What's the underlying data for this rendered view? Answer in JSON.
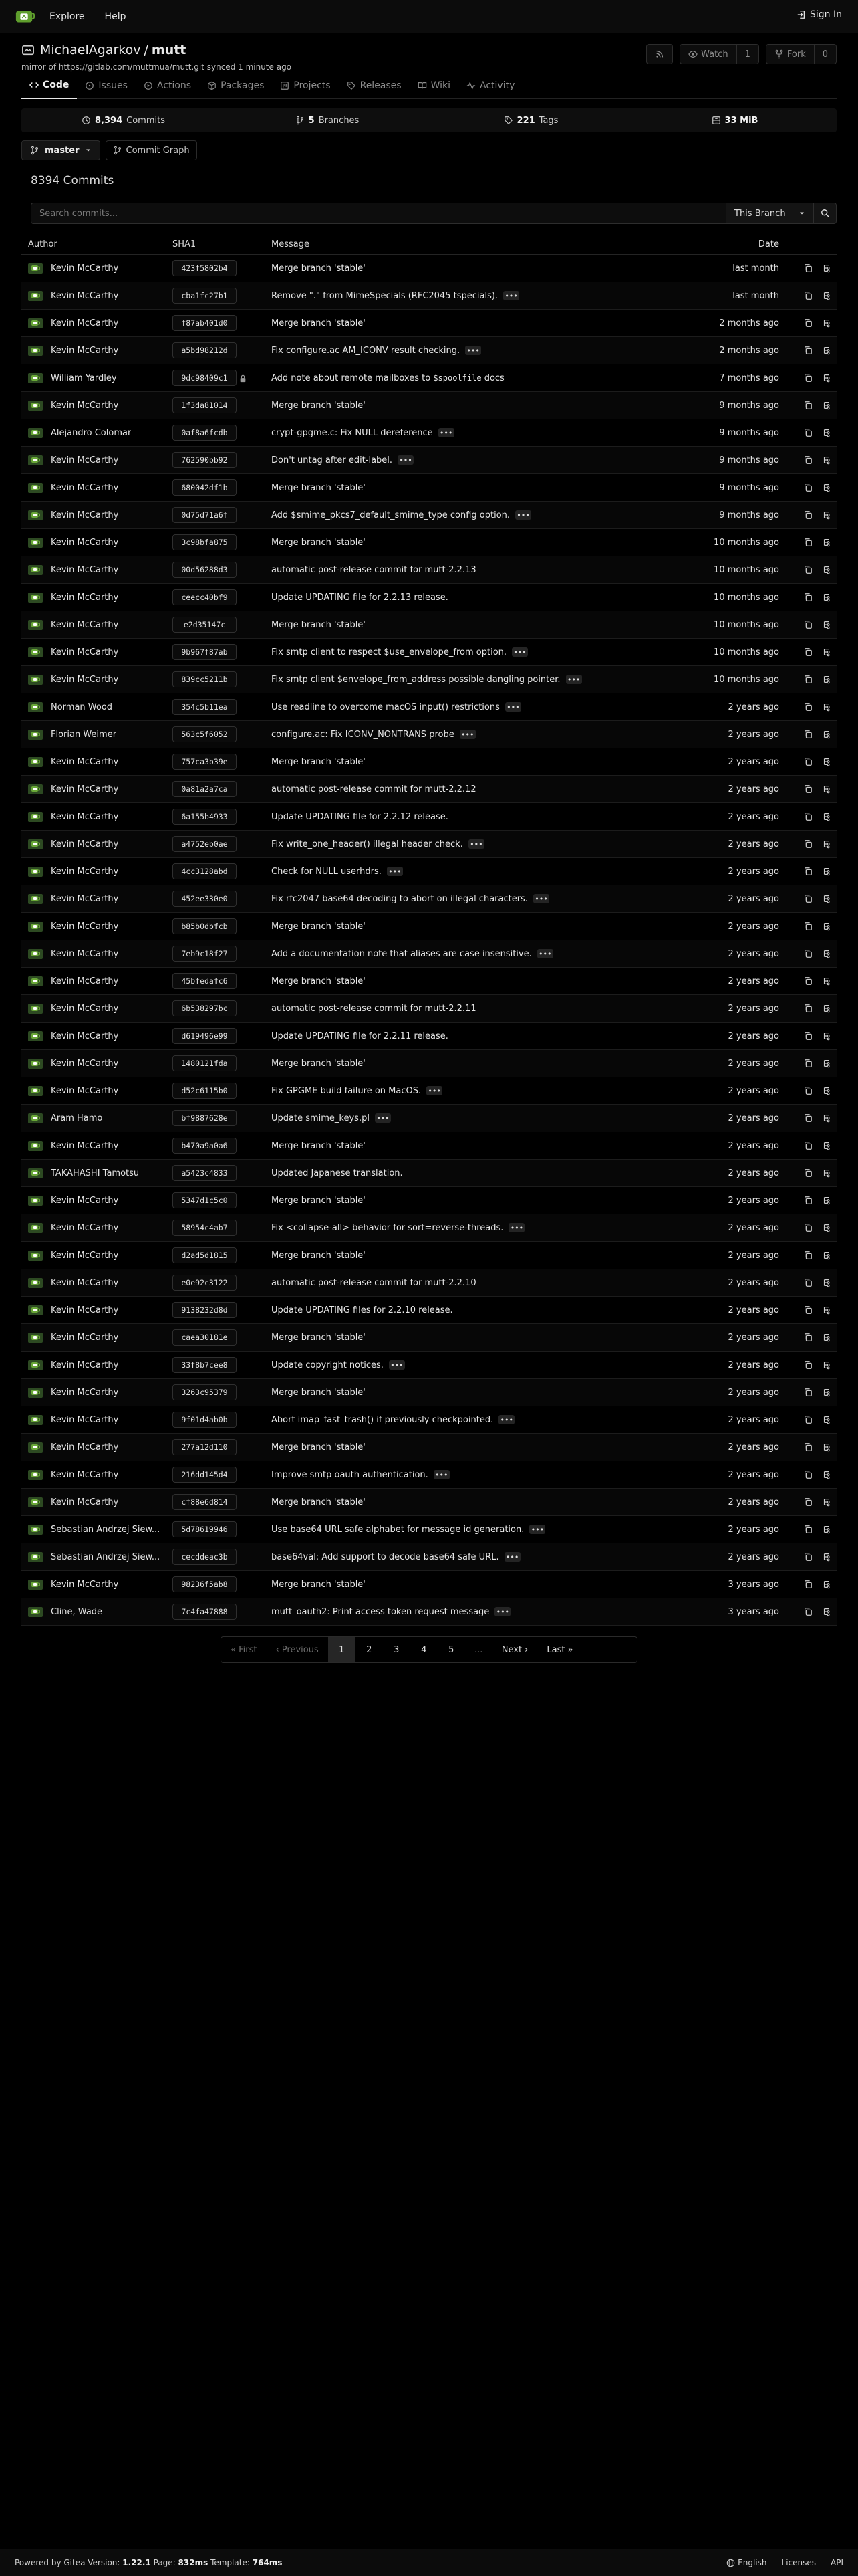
{
  "nav": {
    "explore": "Explore",
    "help": "Help",
    "sign_in": "Sign In"
  },
  "repo": {
    "owner": "MichaelAgarkov",
    "separator": "/",
    "name": "mutt",
    "mirror_prefix": "mirror of ",
    "mirror_url": "https://gitlab.com/muttmua/mutt.git",
    "mirror_synced": " synced 1 minute ago",
    "watch_label": "Watch",
    "watch_count": "1",
    "fork_label": "Fork",
    "fork_count": "0"
  },
  "tabs": [
    {
      "label": "Code",
      "icon": "code-icon"
    },
    {
      "label": "Issues",
      "icon": "issue-icon"
    },
    {
      "label": "Actions",
      "icon": "play-icon"
    },
    {
      "label": "Packages",
      "icon": "package-icon"
    },
    {
      "label": "Projects",
      "icon": "project-icon"
    },
    {
      "label": "Releases",
      "icon": "tag-icon"
    },
    {
      "label": "Wiki",
      "icon": "book-icon"
    },
    {
      "label": "Activity",
      "icon": "pulse-icon"
    }
  ],
  "stats": {
    "commits_count": "8,394",
    "commits_label": "Commits",
    "branches_count": "5",
    "branches_label": "Branches",
    "tags_count": "221",
    "tags_label": "Tags",
    "size_value": "33 MiB"
  },
  "branch": {
    "current": "master",
    "graph_label": "Commit Graph"
  },
  "commits_heading": "8394 Commits",
  "search": {
    "placeholder": "Search commits...",
    "scope": "This Branch"
  },
  "table": {
    "headers": {
      "author": "Author",
      "sha": "SHA1",
      "message": "Message",
      "date": "Date"
    },
    "rows": [
      {
        "author": "Kevin McCarthy",
        "sha": "423f5802b4",
        "message": "Merge branch 'stable'",
        "more": false,
        "date": "last month",
        "signed": false
      },
      {
        "author": "Kevin McCarthy",
        "sha": "cba1fc27b1",
        "message": "Remove \".\" from MimeSpecials (RFC2045 tspecials).",
        "more": true,
        "date": "last month",
        "signed": false
      },
      {
        "author": "Kevin McCarthy",
        "sha": "f87ab401d0",
        "message": "Merge branch 'stable'",
        "more": false,
        "date": "2 months ago",
        "signed": false
      },
      {
        "author": "Kevin McCarthy",
        "sha": "a5bd98212d",
        "message": "Fix configure.ac AM_ICONV result checking.",
        "more": true,
        "date": "2 months ago",
        "signed": false
      },
      {
        "author": "William Yardley",
        "sha": "9dc98409c1",
        "message": "Add note about remote mailboxes to ",
        "code": "$spoolfile",
        "message_after": " docs",
        "more": false,
        "date": "7 months ago",
        "signed": true
      },
      {
        "author": "Kevin McCarthy",
        "sha": "1f3da81014",
        "message": "Merge branch 'stable'",
        "more": false,
        "date": "9 months ago",
        "signed": false
      },
      {
        "author": "Alejandro Colomar",
        "sha": "0af8a6fcdb",
        "message": "crypt-gpgme.c: Fix NULL dereference",
        "more": true,
        "date": "9 months ago",
        "signed": false
      },
      {
        "author": "Kevin McCarthy",
        "sha": "762590bb92",
        "message": "Don't untag after edit-label.",
        "more": true,
        "date": "9 months ago",
        "signed": false
      },
      {
        "author": "Kevin McCarthy",
        "sha": "680042df1b",
        "message": "Merge branch 'stable'",
        "more": false,
        "date": "9 months ago",
        "signed": false
      },
      {
        "author": "Kevin McCarthy",
        "sha": "0d75d71a6f",
        "message": "Add $smime_pkcs7_default_smime_type config option.",
        "more": true,
        "date": "9 months ago",
        "signed": false
      },
      {
        "author": "Kevin McCarthy",
        "sha": "3c98bfa875",
        "message": "Merge branch 'stable'",
        "more": false,
        "date": "10 months ago",
        "signed": false
      },
      {
        "author": "Kevin McCarthy",
        "sha": "00d56288d3",
        "message": "automatic post-release commit for mutt-2.2.13",
        "more": false,
        "date": "10 months ago",
        "signed": false
      },
      {
        "author": "Kevin McCarthy",
        "sha": "ceecc40bf9",
        "message": "Update UPDATING file for 2.2.13 release.",
        "more": false,
        "date": "10 months ago",
        "signed": false
      },
      {
        "author": "Kevin McCarthy",
        "sha": "e2d35147c",
        "message": "Merge branch 'stable'",
        "more": false,
        "date": "10 months ago",
        "signed": false
      },
      {
        "author": "Kevin McCarthy",
        "sha": "9b967f87ab",
        "message": "Fix smtp client to respect $use_envelope_from option.",
        "more": true,
        "date": "10 months ago",
        "signed": false
      },
      {
        "author": "Kevin McCarthy",
        "sha": "839cc5211b",
        "message": "Fix smtp client $envelope_from_address possible dangling pointer.",
        "more": true,
        "date": "10 months ago",
        "signed": false
      },
      {
        "author": "Norman Wood",
        "sha": "354c5b11ea",
        "message": "Use readline to overcome macOS input() restrictions",
        "more": true,
        "date": "2 years ago",
        "signed": false
      },
      {
        "author": "Florian Weimer",
        "sha": "563c5f6052",
        "message": "configure.ac: Fix ICONV_NONTRANS probe",
        "more": true,
        "date": "2 years ago",
        "signed": false
      },
      {
        "author": "Kevin McCarthy",
        "sha": "757ca3b39e",
        "message": "Merge branch 'stable'",
        "more": false,
        "date": "2 years ago",
        "signed": false
      },
      {
        "author": "Kevin McCarthy",
        "sha": "0a81a2a7ca",
        "message": "automatic post-release commit for mutt-2.2.12",
        "more": false,
        "date": "2 years ago",
        "signed": false
      },
      {
        "author": "Kevin McCarthy",
        "sha": "6a155b4933",
        "message": "Update UPDATING file for 2.2.12 release.",
        "more": false,
        "date": "2 years ago",
        "signed": false
      },
      {
        "author": "Kevin McCarthy",
        "sha": "a4752eb0ae",
        "message": "Fix write_one_header() illegal header check.",
        "more": true,
        "date": "2 years ago",
        "signed": false
      },
      {
        "author": "Kevin McCarthy",
        "sha": "4cc3128abd",
        "message": "Check for NULL userhdrs.",
        "more": true,
        "date": "2 years ago",
        "signed": false
      },
      {
        "author": "Kevin McCarthy",
        "sha": "452ee330e0",
        "message": "Fix rfc2047 base64 decoding to abort on illegal characters.",
        "more": true,
        "date": "2 years ago",
        "signed": false
      },
      {
        "author": "Kevin McCarthy",
        "sha": "b85b0dbfcb",
        "message": "Merge branch 'stable'",
        "more": false,
        "date": "2 years ago",
        "signed": false
      },
      {
        "author": "Kevin McCarthy",
        "sha": "7eb9c18f27",
        "message": "Add a documentation note that aliases are case insensitive.",
        "more": true,
        "date": "2 years ago",
        "signed": false
      },
      {
        "author": "Kevin McCarthy",
        "sha": "45bfedafc6",
        "message": "Merge branch 'stable'",
        "more": false,
        "date": "2 years ago",
        "signed": false
      },
      {
        "author": "Kevin McCarthy",
        "sha": "6b538297bc",
        "message": "automatic post-release commit for mutt-2.2.11",
        "more": false,
        "date": "2 years ago",
        "signed": false
      },
      {
        "author": "Kevin McCarthy",
        "sha": "d619496e99",
        "message": "Update UPDATING file for 2.2.11 release.",
        "more": false,
        "date": "2 years ago",
        "signed": false
      },
      {
        "author": "Kevin McCarthy",
        "sha": "1480121fda",
        "message": "Merge branch 'stable'",
        "more": false,
        "date": "2 years ago",
        "signed": false
      },
      {
        "author": "Kevin McCarthy",
        "sha": "d52c6115b0",
        "message": "Fix GPGME build failure on MacOS.",
        "more": true,
        "date": "2 years ago",
        "signed": false
      },
      {
        "author": "Aram Hamo",
        "sha": "bf9887628e",
        "message": "Update smime_keys.pl",
        "more": true,
        "date": "2 years ago",
        "signed": false
      },
      {
        "author": "Kevin McCarthy",
        "sha": "b470a9a0a6",
        "message": "Merge branch 'stable'",
        "more": false,
        "date": "2 years ago",
        "signed": false
      },
      {
        "author": "TAKAHASHI Tamotsu",
        "sha": "a5423c4833",
        "message": "Updated Japanese translation.",
        "more": false,
        "date": "2 years ago",
        "signed": false
      },
      {
        "author": "Kevin McCarthy",
        "sha": "5347d1c5c0",
        "message": "Merge branch 'stable'",
        "more": false,
        "date": "2 years ago",
        "signed": false
      },
      {
        "author": "Kevin McCarthy",
        "sha": "58954c4ab7",
        "message": "Fix <collapse-all> behavior for sort=reverse-threads.",
        "more": true,
        "date": "2 years ago",
        "signed": false
      },
      {
        "author": "Kevin McCarthy",
        "sha": "d2ad5d1815",
        "message": "Merge branch 'stable'",
        "more": false,
        "date": "2 years ago",
        "signed": false
      },
      {
        "author": "Kevin McCarthy",
        "sha": "e0e92c3122",
        "message": "automatic post-release commit for mutt-2.2.10",
        "more": false,
        "date": "2 years ago",
        "signed": false
      },
      {
        "author": "Kevin McCarthy",
        "sha": "9138232d8d",
        "message": "Update UPDATING files for 2.2.10 release.",
        "more": false,
        "date": "2 years ago",
        "signed": false
      },
      {
        "author": "Kevin McCarthy",
        "sha": "caea30181e",
        "message": "Merge branch 'stable'",
        "more": false,
        "date": "2 years ago",
        "signed": false
      },
      {
        "author": "Kevin McCarthy",
        "sha": "33f8b7cee8",
        "message": "Update copyright notices.",
        "more": true,
        "date": "2 years ago",
        "signed": false
      },
      {
        "author": "Kevin McCarthy",
        "sha": "3263c95379",
        "message": "Merge branch 'stable'",
        "more": false,
        "date": "2 years ago",
        "signed": false
      },
      {
        "author": "Kevin McCarthy",
        "sha": "9f01d4ab0b",
        "message": "Abort imap_fast_trash() if previously checkpointed.",
        "more": true,
        "date": "2 years ago",
        "signed": false
      },
      {
        "author": "Kevin McCarthy",
        "sha": "277a12d110",
        "message": "Merge branch 'stable'",
        "more": false,
        "date": "2 years ago",
        "signed": false
      },
      {
        "author": "Kevin McCarthy",
        "sha": "216dd145d4",
        "message": "Improve smtp oauth authentication.",
        "more": true,
        "date": "2 years ago",
        "signed": false
      },
      {
        "author": "Kevin McCarthy",
        "sha": "cf88e6d814",
        "message": "Merge branch 'stable'",
        "more": false,
        "date": "2 years ago",
        "signed": false
      },
      {
        "author": "Sebastian Andrzej Siew...",
        "sha": "5d78619946",
        "message": "Use base64 URL safe alphabet for message id generation.",
        "more": true,
        "date": "2 years ago",
        "signed": false
      },
      {
        "author": "Sebastian Andrzej Siew...",
        "sha": "cecddeac3b",
        "message": "base64val: Add support to decode base64 safe URL.",
        "more": true,
        "date": "2 years ago",
        "signed": false
      },
      {
        "author": "Kevin McCarthy",
        "sha": "98236f5ab8",
        "message": "Merge branch 'stable'",
        "more": false,
        "date": "3 years ago",
        "signed": false
      },
      {
        "author": "Cline, Wade",
        "sha": "7c4fa47888",
        "message": "mutt_oauth2: Print access token request message",
        "more": true,
        "date": "3 years ago",
        "signed": false
      }
    ]
  },
  "pagination": {
    "first": "First",
    "previous": "Previous",
    "pages": [
      "1",
      "2",
      "3",
      "4",
      "5"
    ],
    "gap": "...",
    "next": "Next",
    "last": "Last"
  },
  "footer": {
    "powered": "Powered by Gitea",
    "version_label": "Version:",
    "version": "1.22.1",
    "page_label": "Page:",
    "page_time": "832ms",
    "template_label": "Template:",
    "template_time": "764ms",
    "language": "English",
    "licenses": "Licenses",
    "api": "API"
  }
}
